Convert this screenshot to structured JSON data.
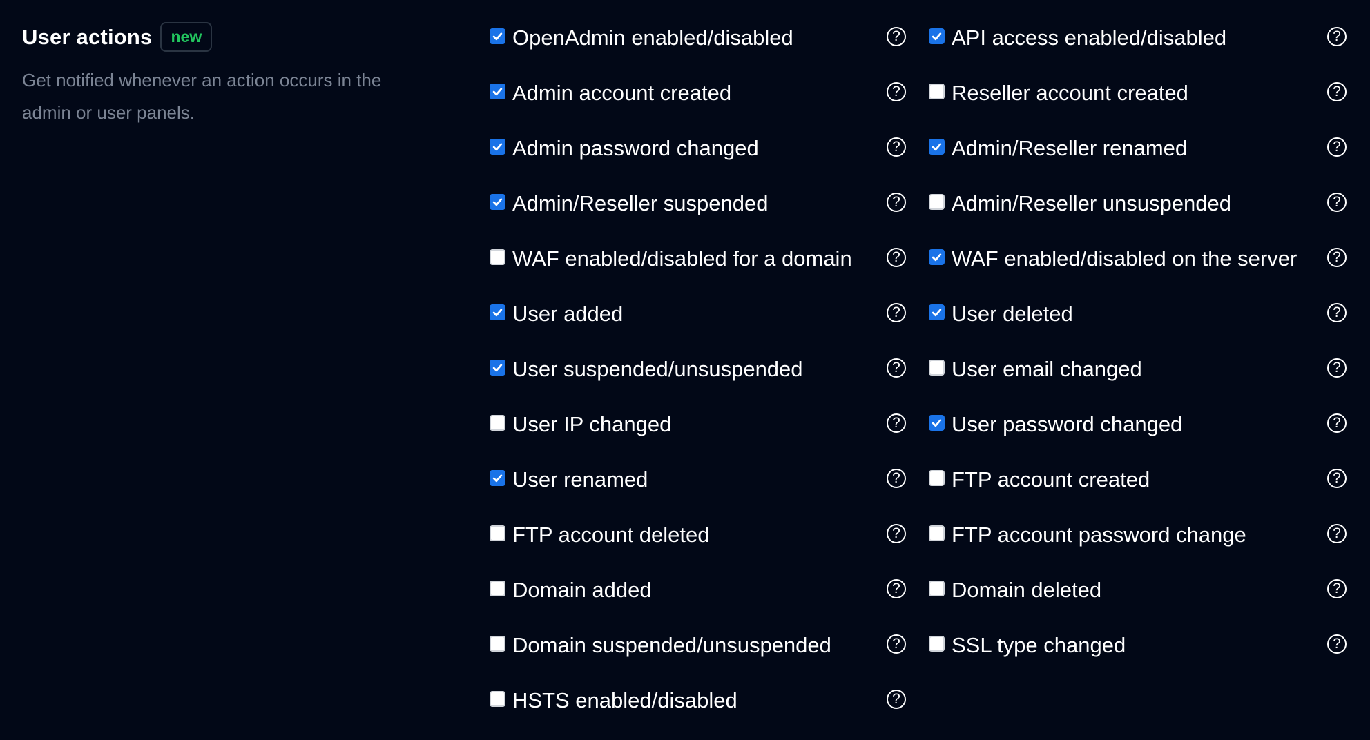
{
  "section": {
    "title": "User actions",
    "badge": "new",
    "description": "Get notified whenever an action occurs in the admin or user panels."
  },
  "colors": {
    "background": "#020817",
    "checkbox_checked": "#1a73e8",
    "badge_text": "#22c55e",
    "description_text": "#7b8494"
  },
  "help_icon": "question-circle-icon",
  "options": [
    {
      "label": "OpenAdmin enabled/disabled",
      "checked": true
    },
    {
      "label": "API access enabled/disabled",
      "checked": true
    },
    {
      "label": "Admin account created",
      "checked": true
    },
    {
      "label": "Reseller account created",
      "checked": false
    },
    {
      "label": "Admin password changed",
      "checked": true
    },
    {
      "label": "Admin/Reseller renamed",
      "checked": true
    },
    {
      "label": "Admin/Reseller suspended",
      "checked": true
    },
    {
      "label": "Admin/Reseller unsuspended",
      "checked": false
    },
    {
      "label": "WAF enabled/disabled for a domain",
      "checked": false
    },
    {
      "label": "WAF enabled/disabled on the server",
      "checked": true
    },
    {
      "label": "User added",
      "checked": true
    },
    {
      "label": "User deleted",
      "checked": true
    },
    {
      "label": "User suspended/unsuspended",
      "checked": true
    },
    {
      "label": "User email changed",
      "checked": false
    },
    {
      "label": "User IP changed",
      "checked": false
    },
    {
      "label": "User password changed",
      "checked": true
    },
    {
      "label": "User renamed",
      "checked": true
    },
    {
      "label": "FTP account created",
      "checked": false
    },
    {
      "label": "FTP account deleted",
      "checked": false
    },
    {
      "label": "FTP account password change",
      "checked": false
    },
    {
      "label": "Domain added",
      "checked": false
    },
    {
      "label": "Domain deleted",
      "checked": false
    },
    {
      "label": "Domain suspended/unsuspended",
      "checked": false
    },
    {
      "label": "SSL type changed",
      "checked": false
    },
    {
      "label": "HSTS enabled/disabled",
      "checked": false
    }
  ]
}
